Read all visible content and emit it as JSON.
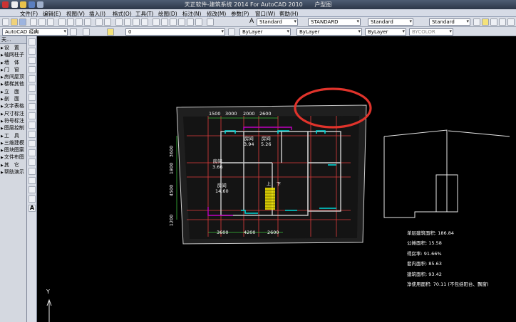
{
  "title_bar": {
    "title": "天正软件-建筑系统 2014  For AutoCAD 2010",
    "extra": "户型图"
  },
  "menu": [
    "文件(F)",
    "编辑(E)",
    "视图(V)",
    "插入(I)",
    "格式(O)",
    "工具(T)",
    "绘图(D)",
    "标注(N)",
    "修改(M)",
    "参数(P)",
    "窗口(W)",
    "帮助(H)"
  ],
  "toolbar1": {
    "text_style": "Standard",
    "dim_style": "STANDARD",
    "table_style": "Standard",
    "multileader_style": "Standard"
  },
  "toolbar2": {
    "workspace": "AutoCAD 经典",
    "layer": "0",
    "color": "ByLayer",
    "linetype": "ByLayer",
    "lineweight": "ByLayer",
    "plotstyle": "BYCOLOR"
  },
  "palette": {
    "header": "天...",
    "items": [
      "设　置",
      "轴网柱子",
      "墙　体",
      "门　窗",
      "房间屋顶",
      "楼梯其他",
      "立　面",
      "剖　面",
      "文字表格",
      "尺寸标注",
      "符号标注",
      "图层控制",
      "工　具",
      "三维建模",
      "图块图案",
      "文件布图",
      "其　它",
      "帮助演示"
    ]
  },
  "plan": {
    "top_dims": [
      "1500",
      "3000",
      "2000",
      "2600"
    ],
    "bottom_dims": [
      "3600",
      "4200",
      "2600"
    ],
    "left_dims": [
      "3600",
      "1800",
      "4500",
      "1200"
    ],
    "rooms": [
      {
        "name": "房间",
        "area": "3.94"
      },
      {
        "name": "房间",
        "area": "5.26"
      },
      {
        "name": "房间",
        "area": "3.66"
      },
      {
        "name": "房间",
        "area": "14.60"
      }
    ],
    "stair_labels": [
      "上",
      "下"
    ]
  },
  "stats": [
    "单层建筑面积: 186.84",
    "公摊面积: 15.58",
    "得房率: 91.66%",
    "套内面积: 85.63",
    "建筑面积: 93.42",
    "净使用面积: 70.11 (不包括阳台、飘窗)"
  ],
  "ucs": {
    "y_label": "Y"
  },
  "colors": {
    "background": "#000000",
    "highlight_ellipse": "#e0332b",
    "dim_line": "#e03c3c",
    "dim_text": "#ffffff",
    "accent_wall": "#c000c0",
    "window": "#00d8d8",
    "stair": "#f2e400"
  }
}
